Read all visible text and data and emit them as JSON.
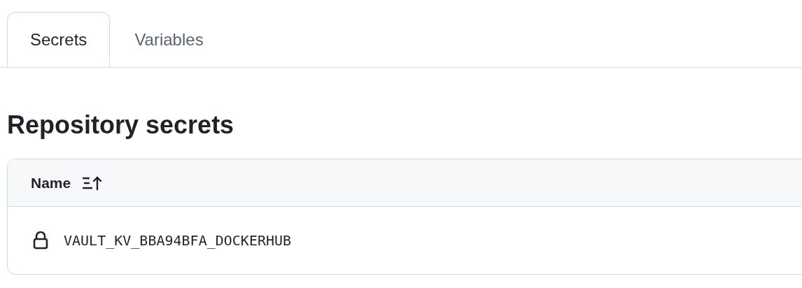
{
  "tabs": [
    {
      "label": "Secrets",
      "selected": true
    },
    {
      "label": "Variables",
      "selected": false
    }
  ],
  "heading": "Repository secrets",
  "table": {
    "columns": [
      {
        "label": "Name",
        "sorted_ascending": true
      }
    ],
    "rows": [
      {
        "name": "VAULT_KV_BBA94BFA_DOCKERHUB"
      }
    ]
  }
}
